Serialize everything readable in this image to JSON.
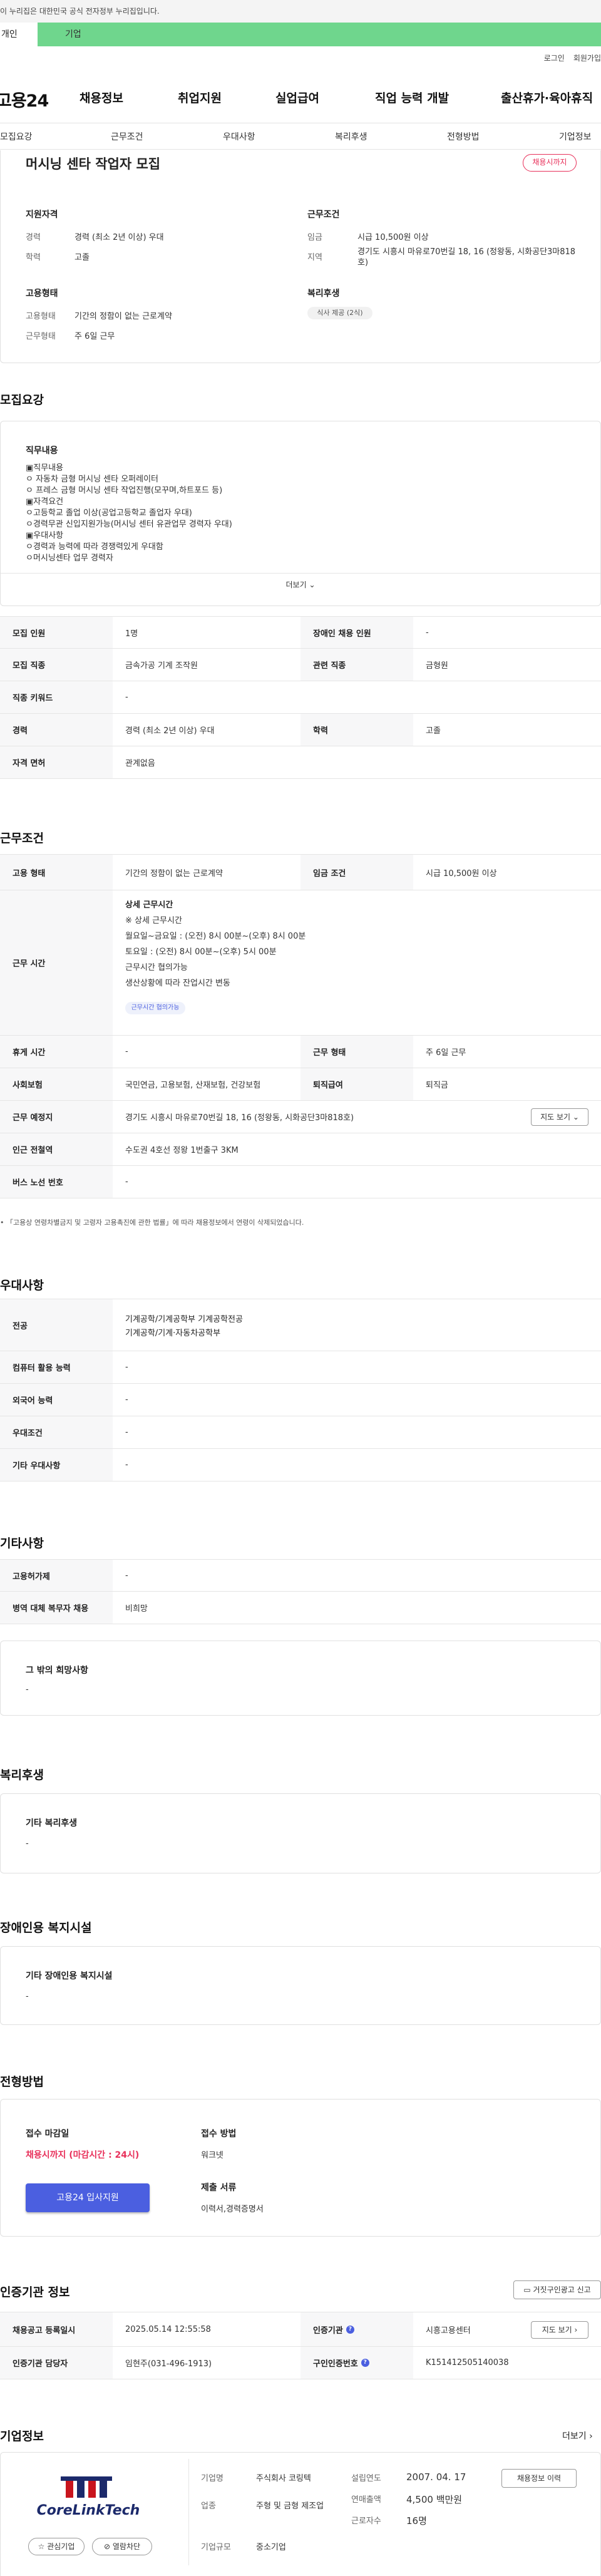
{
  "gov_banner": "이 누리집은 대한민국 공식 전자정부 누리집입니다.",
  "top_tabs": {
    "personal": "개인",
    "company": "기업"
  },
  "util": {
    "login": "로그인",
    "signup": "회원가입"
  },
  "gnb": {
    "logo": "고용24",
    "menu": [
      "채용정보",
      "취업지원",
      "실업급여",
      "직업 능력 개발",
      "출산휴가·육아휴직"
    ]
  },
  "subnav": [
    "모집요강",
    "근무조건",
    "우대사항",
    "복리후생",
    "전형방법",
    "기업정보"
  ],
  "job": {
    "title": "머시닝 센타 작업자 모집",
    "status_badge": "채용시까지",
    "qual_title": "지원자격",
    "career_k": "경력",
    "career_v": "경력 (최소 2년 이상) 우대",
    "edu_k": "학력",
    "edu_v": "고졸",
    "cond_title": "근무조건",
    "wage_k": "임금",
    "wage_v": "시급 10,500원 이상",
    "region_k": "지역",
    "region_v": "경기도 시흥시 마유로70번길 18, 16 (정왕동, 시화공단3마818호)",
    "emp_title": "고용형태",
    "emptype_k": "고용형태",
    "emptype_v": "기간의 정함이 없는 근로계약",
    "worktype_k": "근무형태",
    "worktype_v": "주 6일 근무",
    "welfare_title": "복리후생",
    "welfare_badge": "식사 제공 (2식)"
  },
  "recruit": {
    "title": "모집요강",
    "duty_label": "직무내용",
    "duty_lines": [
      "▣직무내용",
      "ㅇ 자동차 금형 머시닝 센타 오퍼레이터",
      "ㅇ 프레스 금형 머시닝 센타 작업진행(모꾸며,하트포드 등)",
      "▣자격요건",
      "ㅇ고등학교 졸업 이상(공업고등학교 졸업자 우대)",
      "ㅇ경력무관 신입지원가능(머시닝 센터 유관업무 경력자 우대)",
      "▣우대사항",
      "ㅇ경력과 능력에 따라 경쟁력있게 우대함",
      "ㅇ머시닝센타 업무 경력자"
    ],
    "more": "더보기",
    "rows": [
      [
        "모집 인원",
        "1명",
        "장애인 채용 인원",
        "-"
      ],
      [
        "모집 직종",
        "금속가공 기계 조작원",
        "관련 직종",
        "금형원"
      ],
      [
        "직종 키워드",
        "-"
      ],
      [
        "경력",
        "경력 (최소 2년 이상) 우대",
        "학력",
        "고졸"
      ],
      [
        "자격 면허",
        "관계없음"
      ]
    ]
  },
  "workcond": {
    "title": "근무조건",
    "row1": [
      "고용 형태",
      "기간의 정함이 없는 근로계약",
      "임금 조건",
      "시급 10,500원 이상"
    ],
    "hours_k": "근무 시간",
    "hours_title": "상세 근무시간",
    "hours_lines": [
      "※ 상세 근무시간",
      "월요일~금요일 : (오전) 8시 00분~(오후) 8시 00분",
      "토요일 : (오전) 8시 00분~(오후) 5시 00분",
      "근무시간 협의가능",
      "생산상황에 따라 잔업시간 변동"
    ],
    "hours_badge": "근무시간 협의가능",
    "row_rest": [
      "휴게 시간",
      "-",
      "근무 형태",
      "주 6일 근무"
    ],
    "row_ins": [
      "사회보험",
      "국민연금, 고용보험, 산재보험, 건강보험",
      "퇴직급여",
      "퇴직금"
    ],
    "place_k": "근무 예정지",
    "place_v": "경기도 시흥시 마유로70번길 18, 16 (정왕동, 시화공단3마818호)",
    "map_btn": "지도 보기",
    "station_k": "인근 전철역",
    "station_v": "수도권 4호선 정왕 1번출구 3KM",
    "bus_k": "버스 노선 번호",
    "bus_v": "-",
    "note": "「고용상 연령차별금지 및 고령자 고용촉진에 관한 법률」에 따라 채용정보에서 연령이 삭제되었습니다."
  },
  "pref": {
    "title": "우대사항",
    "major_k": "전공",
    "major_lines": [
      "기계공학/기계공학부 기계공학전공",
      "기계공학/기계·자동차공학부"
    ],
    "rows": [
      [
        "컴퓨터 활용 능력",
        "-"
      ],
      [
        "외국어 능력",
        "-"
      ],
      [
        "우대조건",
        "-"
      ],
      [
        "기타 우대사항",
        "-"
      ]
    ]
  },
  "etc": {
    "title": "기타사항",
    "rows": [
      [
        "고용허가제",
        "-"
      ],
      [
        "병역 대체 복무자 채용",
        "비희망"
      ]
    ],
    "other_label": "그 밖의 희망사항",
    "other_v": "-"
  },
  "welfare": {
    "title": "복리후생",
    "label": "기타 복리후생",
    "v": "-"
  },
  "disability": {
    "title": "장애인용 복지시설",
    "label": "기타 장애인용 복지시설",
    "v": "-"
  },
  "process": {
    "title": "전형방법",
    "deadline_k": "접수 마감일",
    "deadline_v": "채용시까지 (마감시간 : 24시)",
    "apply_btn": "고용24 입사지원",
    "method_k": "접수 방법",
    "method_v": "워크넷",
    "docs_k": "제출 서류",
    "docs_v": "이력서,경력증명서"
  },
  "agency": {
    "title": "인증기관 정보",
    "report_btn": "거짓구인광고 신고",
    "r1": [
      "채용공고 등록일시",
      "2025.05.14 12:55:58",
      "인증기관",
      "시흥고용센터"
    ],
    "r2": [
      "인증기관 담당자",
      "임현주(031-496-1913)",
      "구인인증번호",
      "K151412505140038"
    ],
    "map_btn": "지도 보기"
  },
  "company": {
    "title": "기업정보",
    "more": "더보기",
    "logo_text": "CoreLinkTech",
    "fav_btn": "관심기업",
    "block_btn": "열람차단",
    "name_k": "기업명",
    "name_v": "주식회사 코링텍",
    "ind_k": "업종",
    "ind_v": "주형 및 금형 제조업",
    "size_k": "기업규모",
    "size_v": "중소기업",
    "est_k": "설립연도",
    "est_v": "2007. 04. 17",
    "rev_k": "연매출액",
    "rev_v": "4,500 백만원",
    "emp_k": "근로자수",
    "emp_v": "16명",
    "list_btn": "채용정보 이력"
  },
  "colors": {
    "accent_green": "#6fd68d",
    "badge_red": "#e8315b",
    "primary_blue": "#4b5fe0",
    "logo_red": "#c9151e",
    "logo_navy": "#1c2a6b"
  }
}
